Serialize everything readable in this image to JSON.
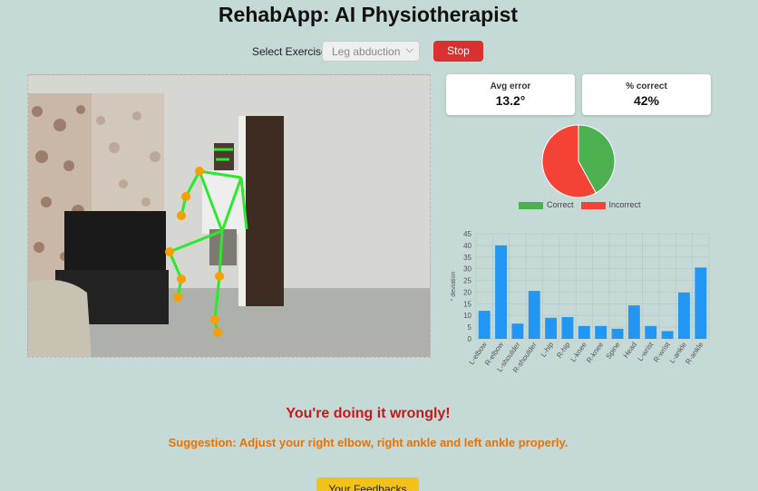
{
  "app": {
    "title": "RehabApp: AI Physiotherapist"
  },
  "controls": {
    "select_label": "Select Exercise:",
    "exercise_selected": "Leg abduction",
    "stop_label": "Stop"
  },
  "stats": {
    "avg_error_label": "Avg error",
    "avg_error_value": "13.2°",
    "pct_correct_label": "% correct",
    "pct_correct_value": "42%"
  },
  "chart_data": [
    {
      "type": "pie",
      "labels": [
        "Correct",
        "Incorrect"
      ],
      "values": [
        42,
        58
      ],
      "colors": [
        "#4caf50",
        "#f44336"
      ],
      "legend": "bottom"
    },
    {
      "type": "bar",
      "categories": [
        "L-elbow",
        "R-elbow",
        "L-shoulder",
        "R-shoulder",
        "L-hip",
        "R-hip",
        "L-knee",
        "R-knee",
        "Spine",
        "Head",
        "L-wrist",
        "R-wrist",
        "L-ankle",
        "R-ankle"
      ],
      "values": [
        12,
        40,
        6.5,
        20.5,
        9,
        9.3,
        5.5,
        5.5,
        4.3,
        14.3,
        5.5,
        3.3,
        19.8,
        30.5
      ],
      "color": "#2196f3",
      "ylabel": "° deviation",
      "ylim": [
        0,
        45
      ],
      "yticks": [
        0,
        5,
        10,
        15,
        20,
        25,
        30,
        35,
        40,
        45
      ],
      "grid": true
    }
  ],
  "feedback": {
    "status": "You're doing it wrongly!",
    "suggestion": "Suggestion: Adjust your right elbow, right ankle and left ankle properly.",
    "button_label": "Your Feedbacks"
  },
  "colors": {
    "background": "#c5d9d6",
    "stop_button": "#d93030",
    "feedback_button": "#f3c21a",
    "error_text": "#c41a1a",
    "suggestion_text": "#e3740b",
    "skeleton_lines": "#2ee82e",
    "skeleton_joints": "#f5a000"
  }
}
